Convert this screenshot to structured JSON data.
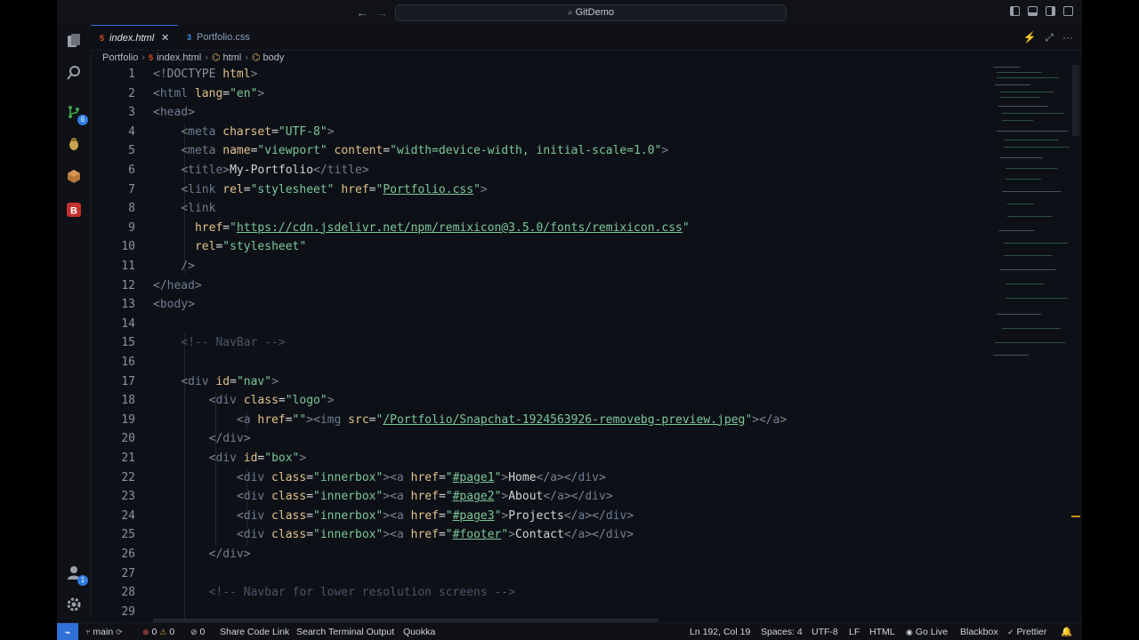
{
  "titlebar": {
    "search_text": "GitDemo"
  },
  "activity": {
    "source_control_badge": "6",
    "account_badge": "1"
  },
  "tabs": [
    {
      "label": "index.html",
      "icon": "html5-icon"
    },
    {
      "label": "Portfolio.css",
      "icon": "css-icon"
    }
  ],
  "breadcrumb": {
    "folder": "Portfolio",
    "file": "index.html",
    "sym1": "html",
    "sym2": "body"
  },
  "line_numbers": [
    "1",
    "2",
    "3",
    "4",
    "5",
    "6",
    "7",
    "8",
    "9",
    "10",
    "11",
    "12",
    "13",
    "14",
    "15",
    "16",
    "17",
    "18",
    "19",
    "20",
    "21",
    "22",
    "23",
    "24",
    "25",
    "26",
    "27",
    "28",
    "29"
  ],
  "code": {
    "l1": {
      "a": "<!",
      "b": "DOCTYPE",
      "c": " html",
      "d": ">"
    },
    "l2": {
      "a": "<",
      "b": "html",
      "c": " lang",
      "d": "=",
      "e": "\"en\"",
      "f": ">"
    },
    "l3": {
      "a": "<",
      "b": "head",
      "c": ">"
    },
    "l4": {
      "a": "<",
      "b": "meta",
      "c": " charset",
      "d": "=",
      "e": "\"UTF-8\"",
      "f": ">"
    },
    "l5": {
      "a": "<",
      "b": "meta",
      "c": " name",
      "d": "=",
      "e": "\"viewport\"",
      "f": " content",
      "g": "=",
      "h": "\"width=device-width, initial-scale=1.0\"",
      "i": ">"
    },
    "l6": {
      "a": "<",
      "b": "title",
      "c": ">",
      "d": "My-Portfolio",
      "e": "</",
      "f": "title",
      "g": ">"
    },
    "l7": {
      "a": "<",
      "b": "link",
      "c": " rel",
      "d": "=",
      "e": "\"stylesheet\"",
      "f": " href",
      "g": "=",
      "h": "\"",
      "i": "Portfolio.css",
      "j": "\"",
      "k": ">"
    },
    "l8": {
      "a": "<",
      "b": "link"
    },
    "l9": {
      "a": "href",
      "b": "=",
      "c": "\"",
      "d": "https://cdn.jsdelivr.net/npm/remixicon@3.5.0/fonts/remixicon.css",
      "e": "\""
    },
    "l10": {
      "a": "rel",
      "b": "=",
      "c": "\"stylesheet\""
    },
    "l11": {
      "a": "/>"
    },
    "l12": {
      "a": "</",
      "b": "head",
      "c": ">"
    },
    "l13": {
      "a": "<",
      "b": "body",
      "c": ">"
    },
    "l15": {
      "a": "<!-- NavBar -->"
    },
    "l17": {
      "a": "<",
      "b": "div",
      "c": " id",
      "d": "=",
      "e": "\"nav\"",
      "f": ">"
    },
    "l18": {
      "a": "<",
      "b": "div",
      "c": " class",
      "d": "=",
      "e": "\"logo\"",
      "f": ">"
    },
    "l19": {
      "a": "<",
      "b": "a",
      "c": " href",
      "d": "=",
      "e": "\"\"",
      "f": "><",
      "g": "img",
      "h": " src",
      "i": "=",
      "j": "\"",
      "k": "/Portfolio/Snapchat-1924563926-removebg-preview.jpeg",
      "l": "\"",
      "m": "></",
      "n": "a",
      "o": ">"
    },
    "l20": {
      "a": "</",
      "b": "div",
      "c": ">"
    },
    "l21": {
      "a": "<",
      "b": "div",
      "c": " id",
      "d": "=",
      "e": "\"box\"",
      "f": ">"
    },
    "l22": {
      "a": "<",
      "b": "div",
      "c": " class",
      "d": "=",
      "e": "\"innerbox\"",
      "f": "><",
      "g": "a",
      "h": " href",
      "i": "=",
      "j": "\"",
      "k": "#page1",
      "l": "\"",
      "m": ">",
      "n": "Home",
      "o": "</",
      "p": "a",
      "q": "></",
      "r": "div",
      "s": ">"
    },
    "l23": {
      "a": "<",
      "b": "div",
      "c": " class",
      "d": "=",
      "e": "\"innerbox\"",
      "f": "><",
      "g": "a",
      "h": " href",
      "i": "=",
      "j": "\"",
      "k": "#page2",
      "l": "\"",
      "m": ">",
      "n": "About",
      "o": "</",
      "p": "a",
      "q": "></",
      "r": "div",
      "s": ">"
    },
    "l24": {
      "a": "<",
      "b": "div",
      "c": " class",
      "d": "=",
      "e": "\"innerbox\"",
      "f": "><",
      "g": "a",
      "h": " href",
      "i": "=",
      "j": "\"",
      "k": "#page3",
      "l": "\"",
      "m": ">",
      "n": "Projects",
      "o": "</",
      "p": "a",
      "q": "></",
      "r": "div",
      "s": ">"
    },
    "l25": {
      "a": "<",
      "b": "div",
      "c": " class",
      "d": "=",
      "e": "\"innerbox\"",
      "f": "><",
      "g": "a",
      "h": " href",
      "i": "=",
      "j": "\"",
      "k": "#footer",
      "l": "\"",
      "m": ">",
      "n": "Contact",
      "o": "</",
      "p": "a",
      "q": "></",
      "r": "div",
      "s": ">"
    },
    "l26": {
      "a": "</",
      "b": "div",
      "c": ">"
    },
    "l28": {
      "a": "<!-- Navbar for lower resolution screens -->"
    }
  },
  "status": {
    "branch": "main",
    "errors": "0",
    "warnings": "0",
    "ports": "0",
    "share": "Share Code Link",
    "search_terminal": "Search Terminal Output",
    "quokka": "Quokka",
    "position": "Ln 192, Col 19",
    "spaces": "Spaces: 4",
    "encoding": "UTF-8",
    "eol": "LF",
    "language": "HTML",
    "golive": "Go Live",
    "blackbox": "Blackbox",
    "prettier": "Prettier"
  },
  "colors": {
    "accent": "#2f6fd6",
    "html_icon": "#e44d26",
    "css_icon": "#3b8ee8",
    "string": "#7ec699",
    "attr": "#e2c08d",
    "tag": "#6e7b91"
  }
}
